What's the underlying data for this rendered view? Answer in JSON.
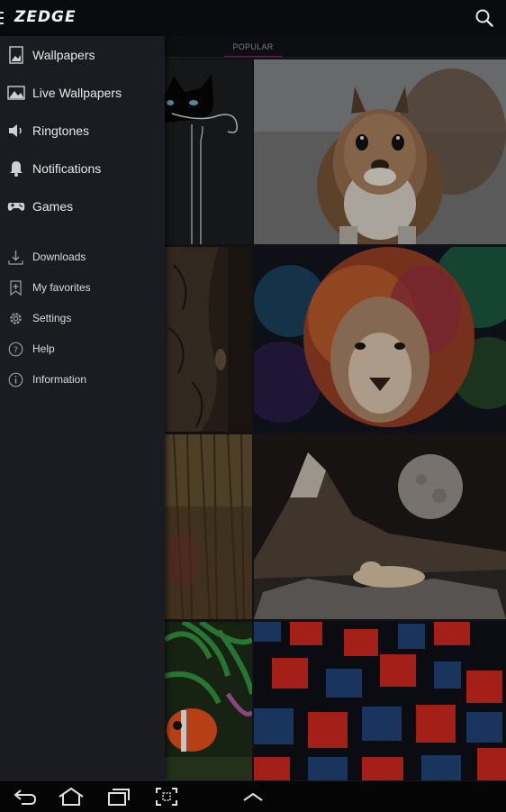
{
  "app": {
    "logo_text": "ZEDGE"
  },
  "topbar": {
    "menu_icon": "hamburger-icon",
    "search_icon": "search-icon"
  },
  "tabs": [
    {
      "label": "POPULAR",
      "selected": true
    }
  ],
  "drawer": {
    "primary": [
      {
        "label": "Wallpapers",
        "icon": "wallpaper-icon"
      },
      {
        "label": "Live Wallpapers",
        "icon": "landscape-icon"
      },
      {
        "label": "Ringtones",
        "icon": "speaker-icon"
      },
      {
        "label": "Notifications",
        "icon": "bell-icon"
      },
      {
        "label": "Games",
        "icon": "gamepad-icon"
      }
    ],
    "secondary": [
      {
        "label": "Downloads",
        "icon": "download-icon"
      },
      {
        "label": "My favorites",
        "icon": "bookmark-plus-icon"
      },
      {
        "label": "Settings",
        "icon": "gear-icon"
      },
      {
        "label": "Help",
        "icon": "help-icon"
      },
      {
        "label": "Information",
        "icon": "info-icon"
      }
    ]
  },
  "wallpapers": [
    {
      "subject": "black-cat-outline"
    },
    {
      "subject": "squirrel"
    },
    {
      "subject": "elephant-skin"
    },
    {
      "subject": "colorful-lion"
    },
    {
      "subject": "fur-texture"
    },
    {
      "subject": "mountain-moon-polar-bears"
    },
    {
      "subject": "clownfish-anemone"
    },
    {
      "subject": "red-blue-cubes"
    }
  ],
  "system_nav": {
    "buttons": [
      "back-icon",
      "home-icon",
      "recent-apps-icon",
      "screenshot-icon",
      "up-chevron-icon"
    ]
  },
  "colors": {
    "accent": "#6b2b63",
    "drawer_bg": "#1a1c21",
    "topbar_bg": "#0a0b0e"
  }
}
